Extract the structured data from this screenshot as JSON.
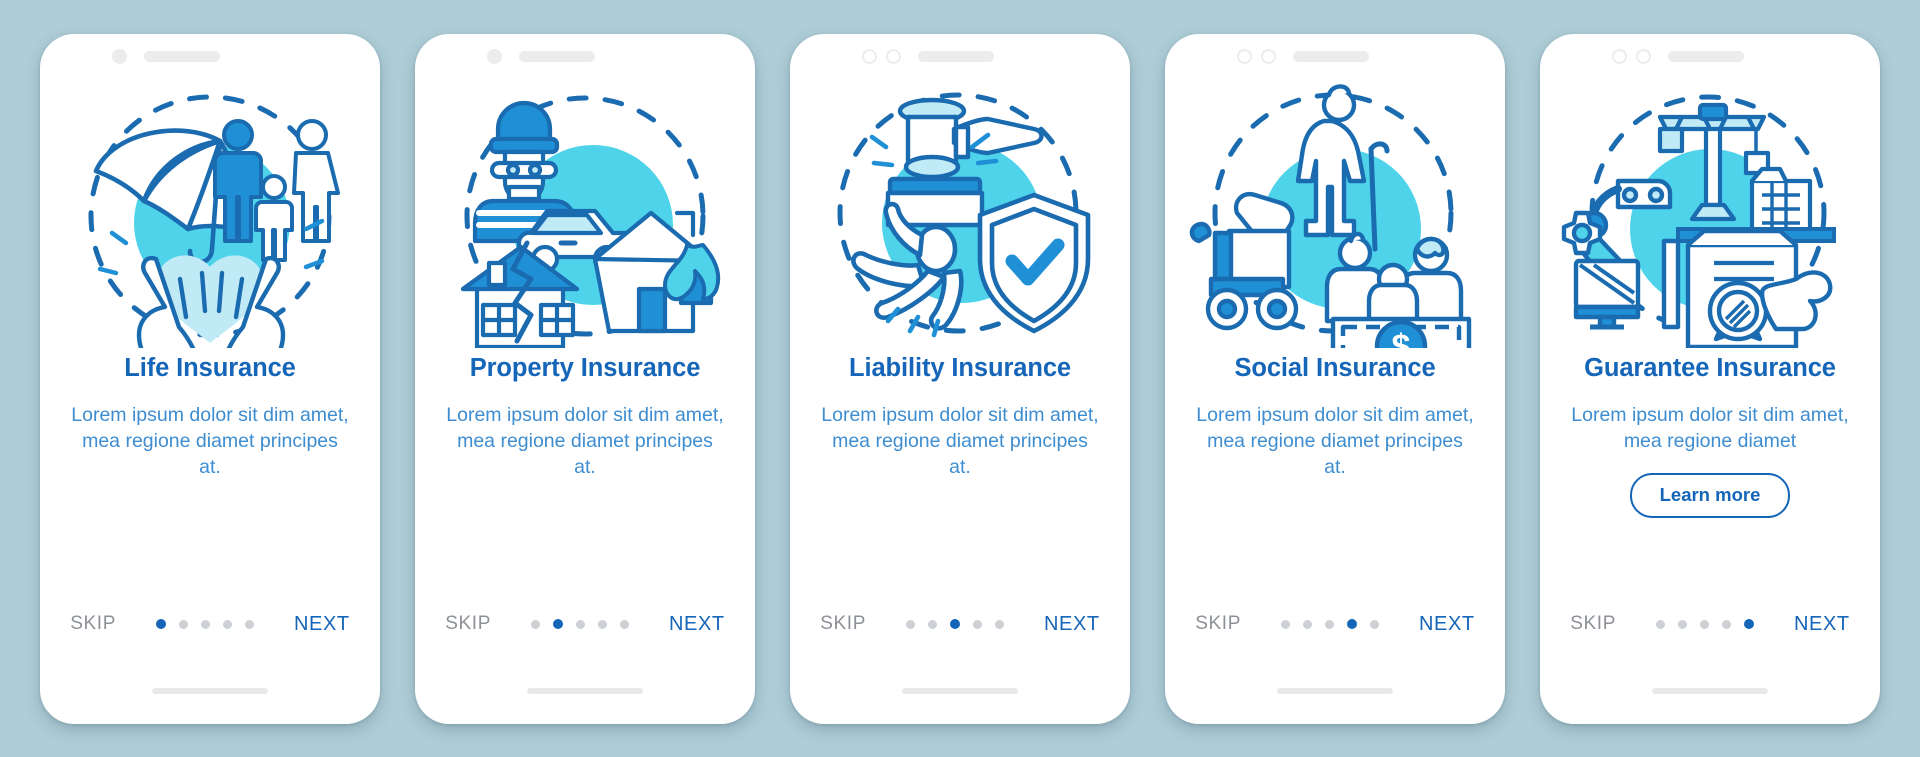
{
  "page": {
    "background_color": "#aecdd7",
    "accent_blue": "#1565b8",
    "body_text_blue": "#3d8dd0",
    "cyan_fill": "#4ed3ea",
    "dash_stroke": "#1b6bb0",
    "muted_gray": "#8d9197",
    "dot_inactive": "#cdd0d4"
  },
  "common": {
    "skip_label": "SKIP",
    "next_label": "NEXT",
    "total_steps": 5
  },
  "screens": [
    {
      "id": "life-insurance",
      "statusbar": {
        "style": "single-dot",
        "dots": 1
      },
      "illustration": "umbrella-family-hands-heart-icon",
      "title": "Life Insurance",
      "body": "Lorem ipsum dolor sit dim amet, mea regione diamet principes at.",
      "cta": null,
      "active_step": 1,
      "skip_label": "SKIP",
      "next_label": "NEXT"
    },
    {
      "id": "property-insurance",
      "statusbar": {
        "style": "single-dot",
        "dots": 1
      },
      "illustration": "thief-car-cracked-house-fire-icon",
      "title": "Property Insurance",
      "body": "Lorem ipsum dolor sit dim amet, mea regione diamet principes at.",
      "cta": null,
      "active_step": 2,
      "skip_label": "SKIP",
      "next_label": "NEXT"
    },
    {
      "id": "liability-insurance",
      "statusbar": {
        "style": "double-ring",
        "dots": 2
      },
      "illustration": "gavel-falling-person-shield-check-icon",
      "title": "Liability Insurance",
      "body": "Lorem ipsum dolor sit dim amet, mea regione diamet principes at.",
      "cta": null,
      "active_step": 3,
      "skip_label": "SKIP",
      "next_label": "NEXT"
    },
    {
      "id": "social-insurance",
      "statusbar": {
        "style": "double-ring",
        "dots": 2
      },
      "illustration": "elderly-wheelchair-family-banknote-icon",
      "title": "Social Insurance",
      "body": "Lorem ipsum dolor sit dim amet, mea regione diamet principes at.",
      "cta": null,
      "active_step": 4,
      "skip_label": "SKIP",
      "next_label": "NEXT"
    },
    {
      "id": "guarantee-insurance",
      "statusbar": {
        "style": "double-ring",
        "dots": 2
      },
      "illustration": "crane-robot-arm-certificate-seal-icon",
      "title": "Guarantee Insurance",
      "body": "Lorem ipsum dolor sit dim amet, mea regione diamet",
      "cta": "Learn more",
      "active_step": 5,
      "skip_label": "SKIP",
      "next_label": "NEXT"
    }
  ]
}
